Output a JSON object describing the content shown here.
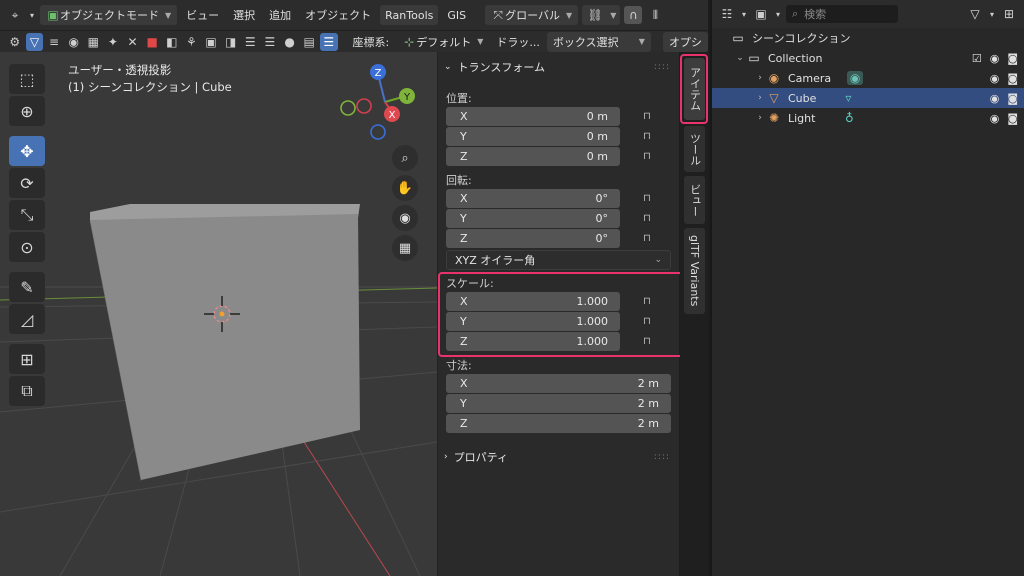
{
  "header": {
    "mode": "オブジェクトモード",
    "menus": [
      "ビュー",
      "選択",
      "追加",
      "オブジェクト"
    ],
    "addons": [
      "RanTools",
      "GIS"
    ],
    "orientation": "グローバル",
    "coord_label": "座標系:",
    "coord_value": "デフォルト",
    "drag_label": "ドラッ...",
    "select_mode": "ボックス選択",
    "options": "オプシ"
  },
  "viewport": {
    "title": "ユーザー・透視投影",
    "subtitle": "(1) シーンコレクション | Cube",
    "gizmo": {
      "z": "Z",
      "y": "Y",
      "x": "X"
    }
  },
  "panel": {
    "transform_header": "トランスフォーム",
    "location_label": "位置:",
    "location": [
      {
        "axis": "X",
        "value": "0 m"
      },
      {
        "axis": "Y",
        "value": "0 m"
      },
      {
        "axis": "Z",
        "value": "0 m"
      }
    ],
    "rotation_label": "回転:",
    "rotation": [
      {
        "axis": "X",
        "value": "0°"
      },
      {
        "axis": "Y",
        "value": "0°"
      },
      {
        "axis": "Z",
        "value": "0°"
      }
    ],
    "rotation_mode": "XYZ オイラー角",
    "scale_label": "スケール:",
    "scale": [
      {
        "axis": "X",
        "value": "1.000"
      },
      {
        "axis": "Y",
        "value": "1.000"
      },
      {
        "axis": "Z",
        "value": "1.000"
      }
    ],
    "dimensions_label": "寸法:",
    "dimensions": [
      {
        "axis": "X",
        "value": "2 m"
      },
      {
        "axis": "Y",
        "value": "2 m"
      },
      {
        "axis": "Z",
        "value": "2 m"
      }
    ],
    "properties_header": "プロパティ"
  },
  "tabs": [
    "アイテム",
    "ツール",
    "ビュー",
    "glTF Variants"
  ],
  "outliner": {
    "search_placeholder": "検索",
    "scene": "シーンコレクション",
    "collection": "Collection",
    "objects": [
      "Camera",
      "Cube",
      "Light"
    ]
  },
  "colors": {
    "highlight": "#e8336d",
    "selected_row": "#334d80",
    "active_tool": "#4772b3"
  }
}
